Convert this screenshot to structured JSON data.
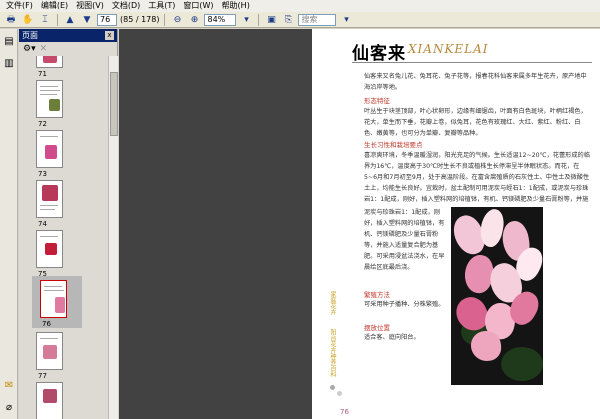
{
  "menu": [
    "文件(F)",
    "编辑(E)",
    "视图(V)",
    "文档(D)",
    "工具(T)",
    "窗口(W)",
    "帮助(H)"
  ],
  "toolbar": {
    "page_value": "76",
    "page_total": "(85 / 178)",
    "zoom_value": "84%",
    "search_placeholder": "搜索"
  },
  "panel": {
    "title": "页面",
    "close": "x"
  },
  "thumbnails": [
    {
      "num": "71",
      "selected": false
    },
    {
      "num": "72",
      "selected": false
    },
    {
      "num": "73",
      "selected": false
    },
    {
      "num": "74",
      "selected": false
    },
    {
      "num": "75",
      "selected": false
    },
    {
      "num": "76",
      "selected": true
    },
    {
      "num": "77",
      "selected": false
    }
  ],
  "page": {
    "title": "仙客来",
    "title_latin": "XIANKELAI",
    "intro": "仙客来又名兔儿花、兔耳花、兔子花等，报春花科仙客来属多年生花卉，原产地中海沿岸等地。",
    "sections": [
      {
        "heading": "形态特征",
        "text": "叶丛生于块茎顶部，叶心状卵形，边缘有细锯齿，叶面有白色斑块，叶柄红褐色，花大，单生而下垂，花瓣上卷，似兔耳，花色有玫瑰红、大红、紫红、粉红、白色、嫩黄等，也可分为单瓣、复瓣等品种。"
      },
      {
        "heading": "生长习性和栽培要点",
        "text": "喜凉爽环境，冬季温暖湿润，阳光充足的气候。生长适温12~20℃，花蕾形成的临界为16℃，温度高于30℃时生长不良或植株生长停滞呈半休眠状态。而花，在5~6月和7月初至9月，处于高温阶段。在富含腐殖质的石灰性土、中性土及微酸性土上，均能生长良好。宜栽时，盆土配制可用泥炭与蛭石1：1配成，或泥炭与珍珠岩1：1配成，刚好，插入塑料网的培植钵，有机、钙镁磷肥及少量石膏粉等，并施入适量复合肥为基肥。可采用浸盆法浇水，在早晨给区底最后浇。"
      }
    ],
    "propagation_heading": "繁殖方法",
    "propagation_text": "可采用种子播种、分株繁殖。",
    "placement_heading": "摆放位置",
    "placement_text": "适合客、庭向阳台。",
    "side_label_1": "家庭花卉",
    "side_label_2": "阳台花卉种养百科",
    "page_num": "76"
  }
}
